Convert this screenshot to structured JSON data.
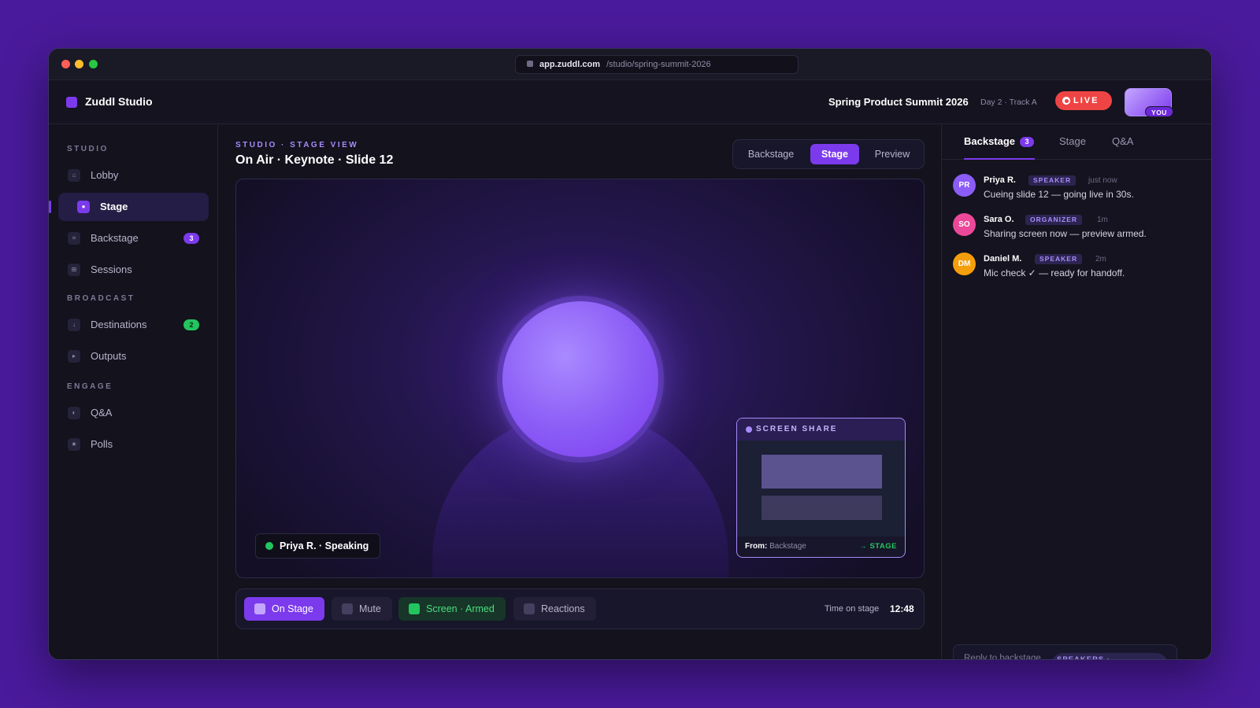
{
  "browser": {
    "host": "app.zuddl.com",
    "path": "/studio/spring-summit-2026"
  },
  "app": {
    "name": "Zuddl Studio"
  },
  "event": {
    "title": "Spring Product Summit 2026",
    "subtitle": "Day 2 · Track A",
    "live_label": "LIVE",
    "you_label": "YOU"
  },
  "sidebar": {
    "sections": [
      {
        "label": "STUDIO",
        "items": [
          {
            "label": "Lobby",
            "icon": "home-icon"
          },
          {
            "label": "Stage",
            "icon": "stage-icon",
            "active": true
          },
          {
            "label": "Backstage",
            "icon": "backstage-icon",
            "count": "3"
          },
          {
            "label": "Sessions",
            "icon": "sessions-icon"
          }
        ]
      },
      {
        "label": "BROADCAST",
        "items": [
          {
            "label": "Destinations",
            "icon": "destinations-icon",
            "count": "2"
          },
          {
            "label": "Outputs",
            "icon": "outputs-icon"
          }
        ]
      },
      {
        "label": "ENGAGE",
        "items": [
          {
            "label": "Q&A",
            "icon": "qa-icon"
          },
          {
            "label": "Polls",
            "icon": "star-icon"
          }
        ]
      }
    ]
  },
  "main": {
    "eyebrow": "STUDIO · STAGE VIEW",
    "title": "On Air · Keynote · Slide 12",
    "view_tabs": [
      "Backstage",
      "Stage",
      "Preview"
    ],
    "active_view": "Stage",
    "speaker_tag": "Priya R. · Speaking",
    "screen_share": {
      "title": "SCREEN SHARE",
      "from_label": "From:",
      "from_value": "Backstage",
      "target": "→ STAGE"
    },
    "controls": [
      "On Stage",
      "Mute",
      "Screen · Armed",
      "Reactions"
    ],
    "timer_label": "Time on stage",
    "timer_value": "12:48"
  },
  "panel": {
    "tabs": [
      "Backstage",
      "Stage",
      "Q&A"
    ],
    "backstage_count": "3",
    "messages": [
      {
        "initials": "PR",
        "name": "Priya R.",
        "role": "SPEAKER",
        "time": "just now",
        "text": "Cueing slide 12 — going live in 30s.",
        "color": "#8b5cf6"
      },
      {
        "initials": "SO",
        "name": "Sara O.",
        "role": "ORGANIZER",
        "time": "1m",
        "text": "Sharing screen now — preview armed.",
        "color": "#ec4899"
      },
      {
        "initials": "DM",
        "name": "Daniel M.",
        "role": "SPEAKER",
        "time": "2m",
        "text": "Mic check ✓ — ready for handoff.",
        "color": "#f59e0b"
      }
    ],
    "reply_placeholder": "Reply to backstage",
    "reply_audience": "SPEAKERS · ORGANIZERS"
  },
  "colors": {
    "accent": "#7c3aed",
    "live": "#ef4444",
    "success": "#22c55e",
    "background": "#4a1a9c"
  }
}
